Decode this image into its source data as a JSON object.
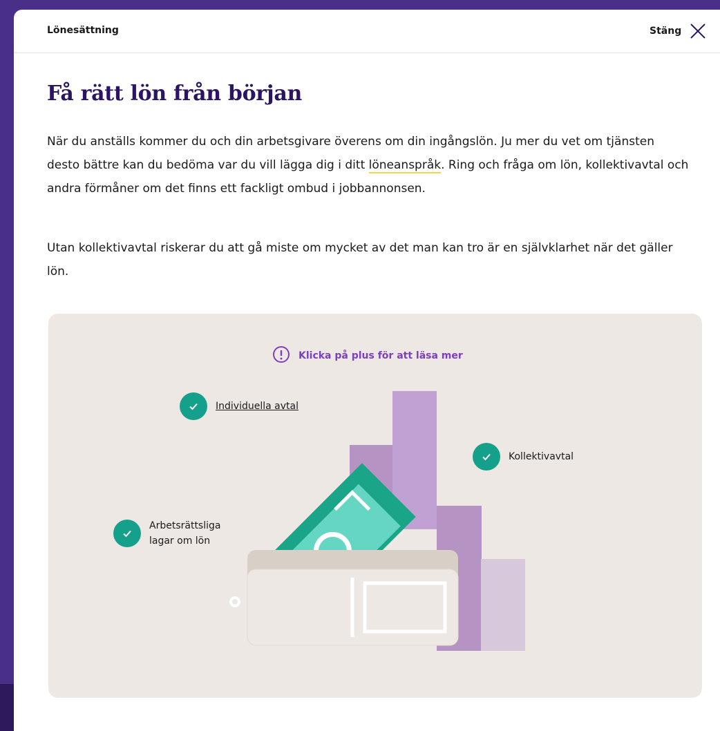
{
  "modal": {
    "header_title": "Lönesättning",
    "close_label": "Stäng"
  },
  "content": {
    "heading": "Få rätt lön från början",
    "para1_before": "När du anställs kommer du och din arbetsgivare överens om din ingångslön. Ju mer du vet om tjänsten desto bättre kan du bedöma var du vill lägga dig i ditt ",
    "para1_link": "löneanspråk",
    "para1_after": ". Ring och fråga om lön, kollektivavtal och andra förmåner om det finns ett fackligt ombud i jobbannonsen.",
    "para2": "Utan kollektivavtal riskerar du att gå miste om mycket av det man kan tro är en självklarhet när det gäller lön."
  },
  "panel": {
    "hint": "Klicka på plus för att läsa mer",
    "items": [
      {
        "label": "Individuella avtal"
      },
      {
        "label": "Kollektivavtal"
      },
      {
        "label": "Arbetsrättsliga lagar om lön"
      }
    ]
  },
  "colors": {
    "heading": "#2a1463",
    "accent_purple": "#7b3fbf",
    "check_green": "#14a08a",
    "panel_bg": "#ede8e3",
    "link_underline": "#f1d54a"
  },
  "icons": {
    "close": "close-icon",
    "hint": "exclamation-circle-icon",
    "check": "check-icon"
  }
}
